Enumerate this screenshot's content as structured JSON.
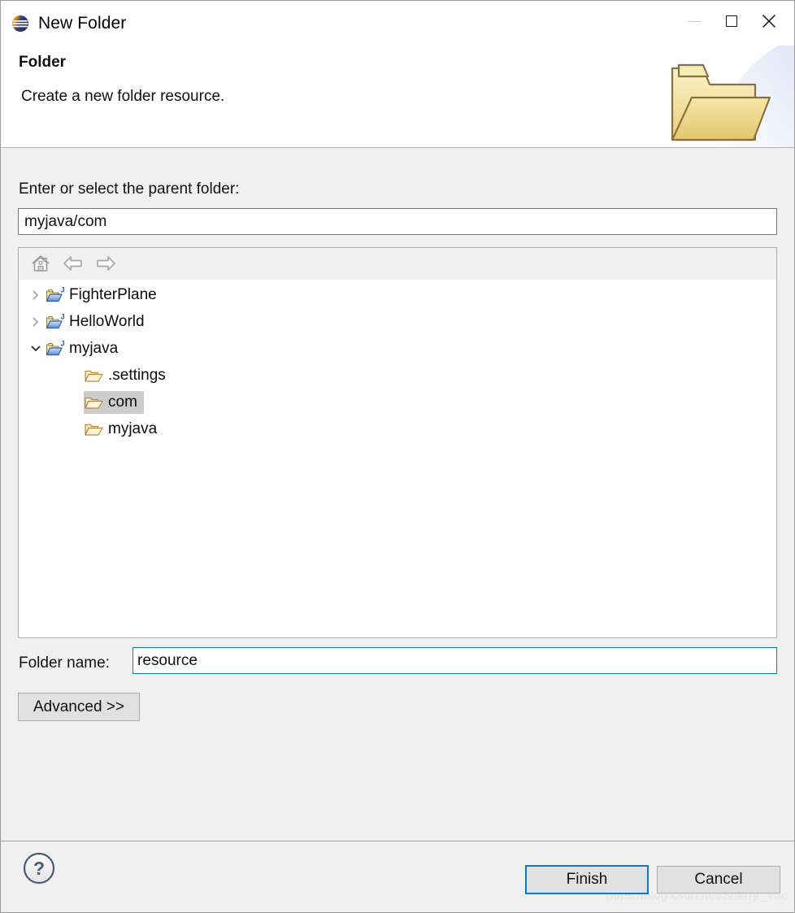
{
  "window": {
    "title": "New Folder",
    "app_icon": "eclipse-logo-icon",
    "controls": {
      "minimize_label": "—",
      "maximize_label": "□",
      "close_label": "✕"
    }
  },
  "header": {
    "title": "Folder",
    "subtitle": "Create a new folder resource.",
    "graphic": "folder-banner-icon"
  },
  "form": {
    "parent_label": "Enter or select the parent folder:",
    "parent_value": "myjava/com",
    "parent_placeholder": "",
    "folder_name_label": "Folder name:",
    "folder_name_value": "resource",
    "folder_name_placeholder": "",
    "advanced_label": "Advanced >>"
  },
  "tree_toolbar": {
    "home_title": "Home",
    "back_title": "Back",
    "forward_title": "Forward"
  },
  "tree": {
    "items": [
      {
        "label": "FighterPlane",
        "indent": 0,
        "twisty": "collapsed",
        "icon": "java-project-folder-icon",
        "selected": false
      },
      {
        "label": "HelloWorld",
        "indent": 0,
        "twisty": "collapsed",
        "icon": "java-project-folder-icon",
        "selected": false
      },
      {
        "label": "myjava",
        "indent": 0,
        "twisty": "expanded",
        "icon": "java-project-folder-icon",
        "selected": false
      },
      {
        "label": ".settings",
        "indent": 1,
        "twisty": "none",
        "icon": "folder-icon",
        "selected": false
      },
      {
        "label": "com",
        "indent": 1,
        "twisty": "none",
        "icon": "folder-icon",
        "selected": true
      },
      {
        "label": "myjava",
        "indent": 1,
        "twisty": "none",
        "icon": "folder-icon",
        "selected": false
      }
    ]
  },
  "footer": {
    "help_label": "?",
    "finish_label": "Finish",
    "cancel_label": "Cancel",
    "watermark": "https://blog.csdn.net/Sherry_Yue"
  },
  "colors": {
    "accent": "#0a7ad0",
    "body_bg": "#f0f0f0",
    "panel_bg": "#ffffff",
    "selection": "#cdcdcd",
    "folder_gold": "#e8b94a",
    "java_blue": "#4f7fd0"
  }
}
